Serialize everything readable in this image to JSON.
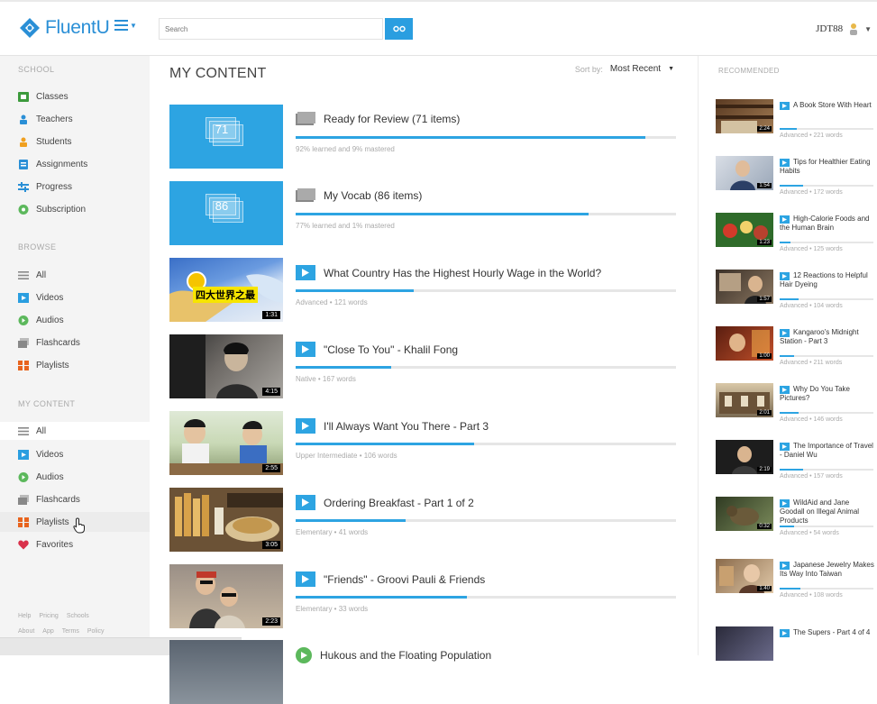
{
  "app": {
    "logo": "FluentU"
  },
  "header": {
    "search_placeholder": "Search",
    "search_button": "GO",
    "user_label": "JDT88"
  },
  "sidebar": {
    "school_heading": "SCHOOL",
    "school_items": [
      {
        "label": "Classes",
        "icon": "classes-icon",
        "color": "#3c9a3c"
      },
      {
        "label": "Teachers",
        "icon": "teachers-icon",
        "color": "#2a8fd6"
      },
      {
        "label": "Students",
        "icon": "students-icon",
        "color": "#f0a020"
      },
      {
        "label": "Assignments",
        "icon": "assignments-icon",
        "color": "#2a8fd6"
      },
      {
        "label": "Progress",
        "icon": "progress-icon",
        "color": "#2a8fd6"
      },
      {
        "label": "Subscription",
        "icon": "subscription-icon",
        "color": "#5cb85c"
      }
    ],
    "browse_heading": "BROWSE",
    "browse_items": [
      {
        "label": "All",
        "icon": "list-icon",
        "color": "#888888"
      },
      {
        "label": "Videos",
        "icon": "video-icon",
        "color": "#2a9ee0"
      },
      {
        "label": "Audios",
        "icon": "audio-icon",
        "color": "#5cb85c"
      },
      {
        "label": "Flashcards",
        "icon": "flashcards-icon",
        "color": "#888888"
      },
      {
        "label": "Playlists",
        "icon": "playlists-icon",
        "color": "#e8641e"
      }
    ],
    "mycontent_heading": "MY CONTENT",
    "mycontent_items": [
      {
        "label": "All",
        "icon": "list-icon",
        "color": "#888888"
      },
      {
        "label": "Videos",
        "icon": "video-icon",
        "color": "#2a9ee0"
      },
      {
        "label": "Audios",
        "icon": "audio-icon",
        "color": "#5cb85c"
      },
      {
        "label": "Flashcards",
        "icon": "flashcards-icon",
        "color": "#888888"
      },
      {
        "label": "Playlists",
        "icon": "playlists-icon",
        "color": "#e8641e"
      },
      {
        "label": "Favorites",
        "icon": "heart-icon",
        "color": "#d9304a"
      }
    ],
    "footer_row1": [
      "Help",
      "Pricing",
      "Schools"
    ],
    "footer_row2": [
      "About",
      "App",
      "Terms",
      "Policy"
    ]
  },
  "main": {
    "title": "MY CONTENT",
    "sort_label": "Sort by:",
    "sort_value": "Most Recent",
    "items": [
      {
        "kind": "collection",
        "count": "71",
        "title": "Ready for Review (71 items)",
        "meta": "92% learned and 9% mastered",
        "progress": 0.92
      },
      {
        "kind": "collection",
        "count": "86",
        "title": "My Vocab (86 items)",
        "meta": "77% learned and 1% mastered",
        "progress": 0.77
      },
      {
        "kind": "video",
        "title": "What Country Has the Highest Hourly Wage in the World?",
        "meta": "Advanced • 121 words",
        "duration": "1:31",
        "overlay": "四大世界之最",
        "progress": 0.31
      },
      {
        "kind": "video",
        "title": "\"Close To You\" - Khalil Fong",
        "meta": "Native • 167 words",
        "duration": "4:15",
        "progress": 0.25
      },
      {
        "kind": "video",
        "title": "I'll Always Want You There - Part 3",
        "meta": "Upper Intermediate • 106 words",
        "duration": "2:55",
        "progress": 0.47
      },
      {
        "kind": "video",
        "title": "Ordering Breakfast - Part 1 of 2",
        "meta": "Elementary • 41 words",
        "duration": "3:05",
        "progress": 0.29
      },
      {
        "kind": "video",
        "title": "\"Friends\" - Groovi Pauli & Friends",
        "meta": "Elementary • 33 words",
        "duration": "2:23",
        "progress": 0.45
      },
      {
        "kind": "audio",
        "title": "Hukous and the Floating Population",
        "meta": "",
        "duration": "",
        "progress": 0
      }
    ]
  },
  "recommended": {
    "heading": "RECOMMENDED",
    "items": [
      {
        "title": "A Book Store With Heart",
        "meta": "Advanced • 221 words",
        "duration": "2:24",
        "progress": 0.18
      },
      {
        "title": "Tips for Healthier Eating Habits",
        "meta": "Advanced • 172 words",
        "duration": "1:54",
        "progress": 0.25
      },
      {
        "title": "High-Calorie Foods and the Human Brain",
        "meta": "Advanced • 125 words",
        "duration": "1:23",
        "progress": 0.12
      },
      {
        "title": "12 Reactions to Helpful Hair Dyeing",
        "meta": "Advanced • 104 words",
        "duration": "1:57",
        "progress": 0.2
      },
      {
        "title": "Kangaroo's Midnight Station - Part 3",
        "meta": "Advanced • 211 words",
        "duration": "1:00",
        "progress": 0.15
      },
      {
        "title": "Why Do You Take Pictures?",
        "meta": "Advanced • 146 words",
        "duration": "2:01",
        "progress": 0.2
      },
      {
        "title": "The Importance of Travel - Daniel Wu",
        "meta": "Advanced • 157 words",
        "duration": "2:19",
        "progress": 0.25
      },
      {
        "title": "WildAid and Jane Goodall on Illegal Animal Products",
        "meta": "Advanced • 54 words",
        "duration": "0:32",
        "progress": 0.15
      },
      {
        "title": "Japanese Jewelry Makes Its Way Into Taiwan",
        "meta": "Advanced • 108 words",
        "duration": "1:40",
        "progress": 0.22
      },
      {
        "title": "The Supers - Part 4 of 4",
        "meta": "",
        "duration": "",
        "progress": 0
      }
    ]
  }
}
